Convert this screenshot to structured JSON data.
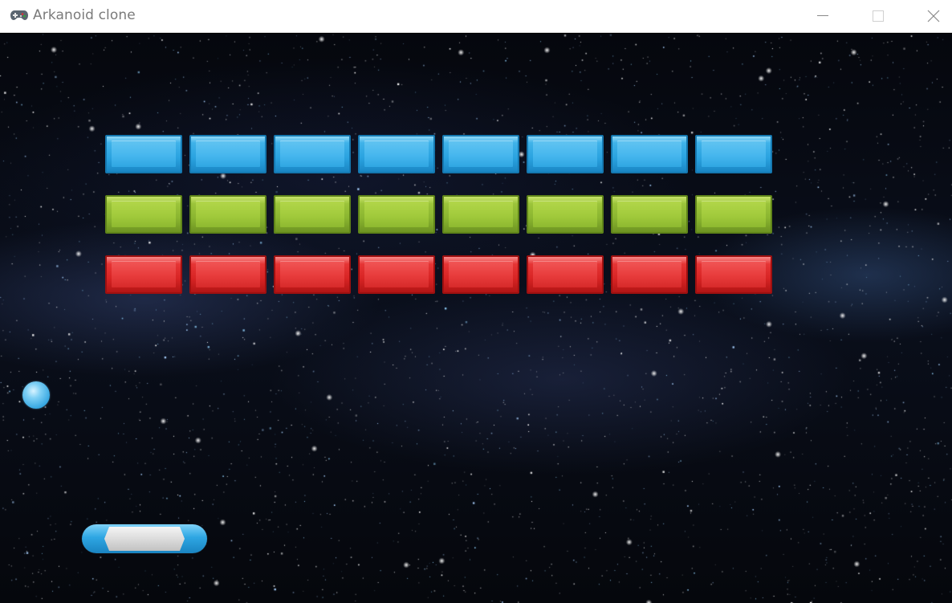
{
  "window": {
    "title": "Arkanoid clone",
    "app_icon": "gamepad-icon",
    "controls": {
      "minimize_icon": "minimize-icon",
      "maximize_icon": "maximize-icon",
      "close_icon": "close-icon"
    }
  },
  "game": {
    "background": "starfield",
    "brick_rows": [
      {
        "color": "blue",
        "count": 8
      },
      {
        "color": "green",
        "count": 8
      },
      {
        "color": "red",
        "count": 8
      }
    ],
    "colors": {
      "blue": "#2aa3e0",
      "green": "#9cc43a",
      "red": "#e02a2a",
      "paddle_core": "#d9d9d9"
    },
    "ball": {
      "color": "#3aa9e2"
    },
    "paddle": {
      "color": "#2ea6e3"
    }
  }
}
